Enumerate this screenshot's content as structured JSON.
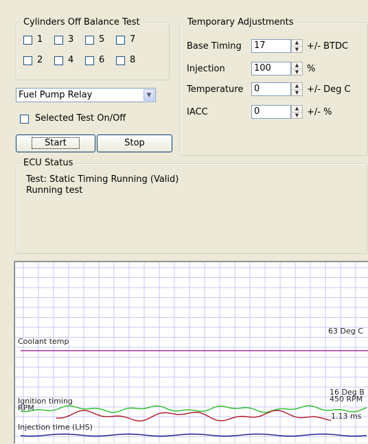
{
  "cylinders": {
    "title": "Cylinders Off Balance Test",
    "row1": [
      "1",
      "3",
      "5",
      "7"
    ],
    "row2": [
      "2",
      "4",
      "6",
      "8"
    ]
  },
  "relay_select": {
    "value": "Fuel Pump Relay"
  },
  "selected_test": {
    "label": "Selected Test On/Off",
    "checked": false
  },
  "buttons": {
    "start": "Start",
    "stop": "Stop"
  },
  "adjustments": {
    "title": "Temporary Adjustments",
    "rows": [
      {
        "label": "Base Timing",
        "value": "17",
        "unit": "+/- BTDC"
      },
      {
        "label": "Injection",
        "value": "100",
        "unit": "%"
      },
      {
        "label": "Temperature",
        "value": "0",
        "unit": "+/- Deg C"
      },
      {
        "label": "IACC",
        "value": "0",
        "unit": "+/- %"
      }
    ]
  },
  "ecu_status": {
    "title": "ECU Status",
    "line1": "Test: Static Timing Running (Valid)",
    "line2": "Running test"
  },
  "graph": {
    "labels": {
      "coolant": "Coolant temp",
      "coolant_value": "63 Deg C",
      "ignition": "Ignition timing",
      "rpm": "RPM",
      "ignition_value": "16 Deg B",
      "rpm_value": "450 RPM",
      "injection": "Injection time (LHS)",
      "injection_value": "1.13 ms"
    },
    "colors": {
      "grid": "#c9c9f0",
      "coolant": "#a030a0",
      "rpm": "#30c030",
      "ignition": "#b02030",
      "injection": "#202090"
    }
  }
}
